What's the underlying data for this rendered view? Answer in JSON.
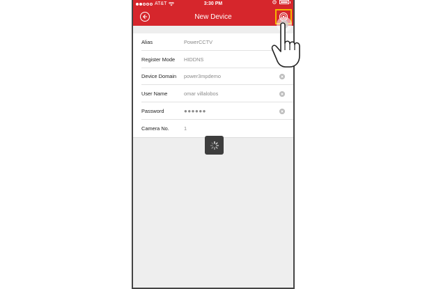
{
  "status_bar": {
    "carrier": "AT&T",
    "time": "3:30 PM"
  },
  "nav": {
    "title": "New Device",
    "back_icon": "back-arrow-icon",
    "action_icon": "fingerprint-save-icon"
  },
  "form": {
    "rows": [
      {
        "label": "Alias",
        "value": "PowerCCTV",
        "clearable": false
      },
      {
        "label": "Register Mode",
        "value": "HIDDNS",
        "clearable": false
      },
      {
        "label": "Device Domain",
        "value": "power3mpdemo",
        "clearable": true
      },
      {
        "label": "User Name",
        "value": "omar villalobos",
        "clearable": true
      },
      {
        "label": "Password",
        "value": "●●●●●●",
        "clearable": true
      },
      {
        "label": "Camera No.",
        "value": "1",
        "clearable": false
      }
    ]
  },
  "colors": {
    "primary": "#d6262c",
    "highlight": "#f5b400",
    "background": "#eeeeee"
  }
}
